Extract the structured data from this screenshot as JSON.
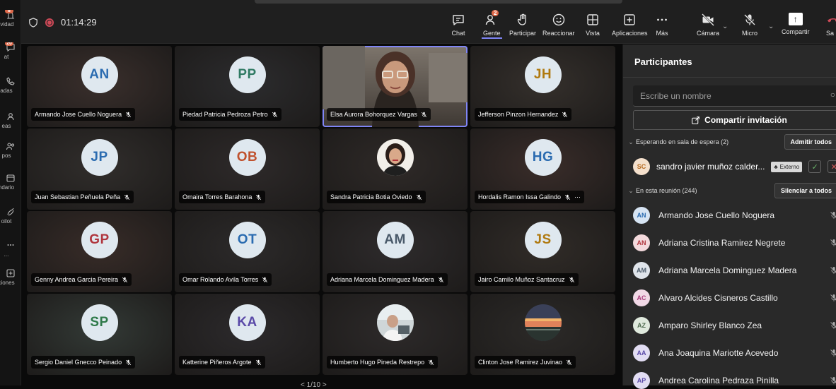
{
  "rail": {
    "items": [
      {
        "label": "ividad",
        "badge": "8",
        "icon": "bell-icon"
      },
      {
        "label": "at",
        "badge": "20",
        "icon": "chat-icon"
      },
      {
        "label": "adas",
        "badge": "",
        "icon": "phone-icon"
      },
      {
        "label": "eas",
        "badge": "",
        "icon": "team-icon"
      },
      {
        "label": "pos",
        "badge": "",
        "icon": "people-icon"
      },
      {
        "label": "ndario",
        "badge": "",
        "icon": "calendar-icon"
      },
      {
        "label": "oilot",
        "badge": "",
        "icon": "copilot-icon"
      },
      {
        "label": "...",
        "badge": "",
        "icon": "more-icon"
      },
      {
        "label": "ciones",
        "badge": "",
        "icon": "apps-icon"
      }
    ]
  },
  "toolbar": {
    "timer": "01:14:29",
    "chat": "Chat",
    "people": "Gente",
    "people_badge": "2",
    "raise": "Participar",
    "react": "Reaccionar",
    "view": "Vista",
    "apps": "Aplicaciones",
    "more": "Más",
    "camera": "Cámara",
    "mic": "Micro",
    "share": "Compartir",
    "leave": "Sa"
  },
  "tiles": [
    {
      "initials": "AN",
      "name": "Armando Jose Cuello Noguera",
      "color": "#2a6bb0",
      "bg": "#3a2f2c",
      "photo": ""
    },
    {
      "initials": "PP",
      "name": "Piedad Patricia Pedroza Petro",
      "color": "#2f7a63",
      "bg": "#2c2c2e",
      "photo": ""
    },
    {
      "initials": "",
      "name": "Elsa Aurora Bohorquez Vargas",
      "color": "",
      "bg": "#6a6058",
      "photo": "video"
    },
    {
      "initials": "JH",
      "name": "Jefferson Pinzon Hernandez",
      "color": "#b07a10",
      "bg": "#35302c",
      "photo": ""
    },
    {
      "initials": "JP",
      "name": "Juan Sebastian Peñuela Peña",
      "color": "#2a6bb0",
      "bg": "#312e2c",
      "photo": ""
    },
    {
      "initials": "OB",
      "name": "Omaira Torres Barahona",
      "color": "#c0522e",
      "bg": "#2e2a2a",
      "photo": ""
    },
    {
      "initials": "",
      "name": "Sandra Patricia Botia Oviedo",
      "color": "",
      "bg": "#2f2a28",
      "photo": "portrait"
    },
    {
      "initials": "HG",
      "name": "Hordalis Ramon Issa Galindo",
      "color": "#2a6bb0",
      "bg": "#3a2d2a",
      "photo": ""
    },
    {
      "initials": "GP",
      "name": "Genny Andrea Garcia Pereira",
      "color": "#b0363e",
      "bg": "#382c28",
      "photo": ""
    },
    {
      "initials": "OT",
      "name": "Omar Rolando Avila Torres",
      "color": "#2a6bb0",
      "bg": "#2c2a2a",
      "photo": ""
    },
    {
      "initials": "AM",
      "name": "Adriana Marcela Dominguez Madera",
      "color": "#4a5a6a",
      "bg": "#2e2b2c",
      "photo": ""
    },
    {
      "initials": "JS",
      "name": "Jairo Camilo Muñoz Santacruz",
      "color": "#b07a10",
      "bg": "#312c28",
      "photo": ""
    },
    {
      "initials": "SP",
      "name": "Sergio Daniel Gnecco Peinado",
      "color": "#2f7a4a",
      "bg": "#333a36",
      "photo": ""
    },
    {
      "initials": "KA",
      "name": "Katterine Piñeros Argote",
      "color": "#5a4aa8",
      "bg": "#2c2a2c",
      "photo": ""
    },
    {
      "initials": "",
      "name": "Humberto Hugo Pineda Restrepo",
      "color": "",
      "bg": "#2d2a2a",
      "photo": "portrait2"
    },
    {
      "initials": "",
      "name": "Clinton Jose Ramirez Juvinao",
      "color": "",
      "bg": "#2c2a28",
      "photo": "sunset"
    }
  ],
  "tile_more": "···",
  "pager": "< 1/10 >",
  "panel": {
    "title": "Participantes",
    "search_placeholder": "Escribe un nombre",
    "invite": "Compartir invitación",
    "lobby_header": "Esperando en sala de espera (2)",
    "admit_all": "Admitir todos",
    "lobby_person": {
      "initials": "SC",
      "name": "sandro javier muñoz calder...",
      "tag": "Externo",
      "color": "#b56a1f",
      "bg": "#f4e0cc"
    },
    "meeting_header": "En esta reunión (244)",
    "mute_all": "Silenciar a todos",
    "people": [
      {
        "initials": "AN",
        "name": "Armando Jose Cuello Noguera",
        "color": "#2a6bb0",
        "bg": "#d6e4f3"
      },
      {
        "initials": "AN",
        "name": "Adriana Cristina Ramirez Negrete",
        "color": "#b0363e",
        "bg": "#f3d9dc"
      },
      {
        "initials": "AM",
        "name": "Adriana Marcela Dominguez Madera",
        "color": "#4a5a6a",
        "bg": "#dfe4ea"
      },
      {
        "initials": "AC",
        "name": "Alvaro Alcides Cisneros Castillo",
        "color": "#a83a7a",
        "bg": "#f1d8e6"
      },
      {
        "initials": "AZ",
        "name": "Amparo Shirley Blanco Zea",
        "color": "#4e6a4e",
        "bg": "#dfe9dd"
      },
      {
        "initials": "AA",
        "name": "Ana Joaquina Mariotte Acevedo",
        "color": "#5a4aa8",
        "bg": "#e2ddf3"
      },
      {
        "initials": "AP",
        "name": "Andrea Carolina Pedraza Pinilla",
        "color": "#5a4aa8",
        "bg": "#e2ddf3"
      }
    ]
  }
}
